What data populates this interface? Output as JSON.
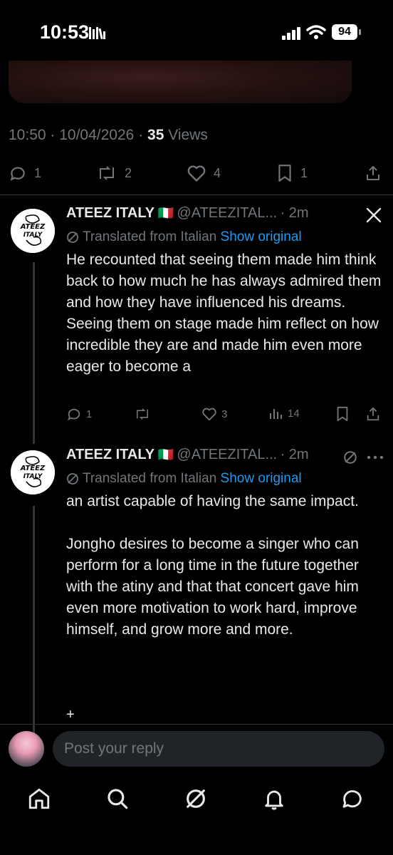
{
  "status": {
    "time": "10:53",
    "battery": "94"
  },
  "tweet": {
    "time": "10:50",
    "date": "10/04/2026",
    "views_count": "35",
    "views_label": "Views",
    "replies": "1",
    "reposts": "2",
    "likes": "4",
    "bookmarks": "1"
  },
  "replies": [
    {
      "name": "ATEEZ ITALY",
      "flag": "🇮🇹",
      "handle": "@ATEEZITAL...",
      "age": "· 2m",
      "avatar_text": "ATEEZ\nITALY",
      "translated": "Translated from Italian",
      "show_original": "Show original",
      "text": "He recounted that seeing them made him think back to how much he has always admired them and how they have influenced his dreams. Seeing them on stage made him reflect on how incredible they are and made him even more eager to become a",
      "stats": {
        "replies": "1",
        "reposts": "",
        "likes": "3",
        "views": "14"
      }
    },
    {
      "name": "ATEEZ ITALY",
      "flag": "🇮🇹",
      "handle": "@ATEEZITAL...",
      "age": "· 2m",
      "avatar_text": "ATEEZ\nITALY",
      "translated": "Translated from Italian",
      "show_original": "Show original",
      "text": "an artist capable of having the same impact.\n\nJongho desires to become a singer who can perform for a long time in the future together with the atiny and that that concert gave him even more motivation to work hard, improve himself, and grow more and more.",
      "plus": "+"
    }
  ],
  "reply_box": {
    "placeholder": "Post your reply"
  }
}
